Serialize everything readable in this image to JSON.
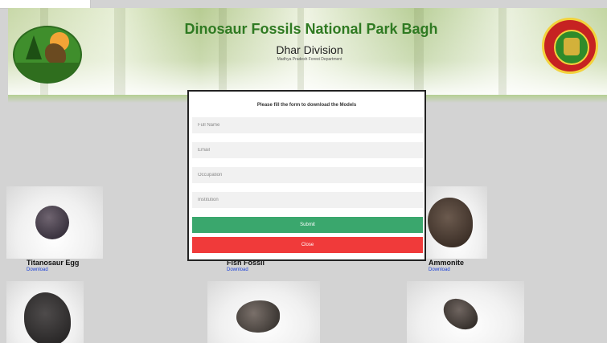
{
  "header": {
    "title": "Dinosaur Fossils National Park Bagh",
    "division": "Dhar Division",
    "subtitle": "Madhya Pradesh Forest Department",
    "left_logo_icon": "dinosaur-park-logo",
    "right_logo_icon": "state-emblem-seal"
  },
  "modal": {
    "title": "Please fill the form to download the Models",
    "fields": {
      "full_name": "Full Name",
      "email": "Email",
      "occupation": "Occupation",
      "institution": "Institution"
    },
    "submit_label": "Submit",
    "close_label": "Close"
  },
  "cards": [
    {
      "title": "Titanosaur Egg",
      "link": "Download"
    },
    {
      "title": "Fish Fossil",
      "link": "Download"
    },
    {
      "title": "Ammonite",
      "link": "Download"
    }
  ],
  "colors": {
    "title_green": "#2f7a22",
    "submit_green": "#3aa76d",
    "close_red": "#f03a3a",
    "link_blue": "#1a3fd6",
    "page_gray": "#d3d3d3"
  }
}
